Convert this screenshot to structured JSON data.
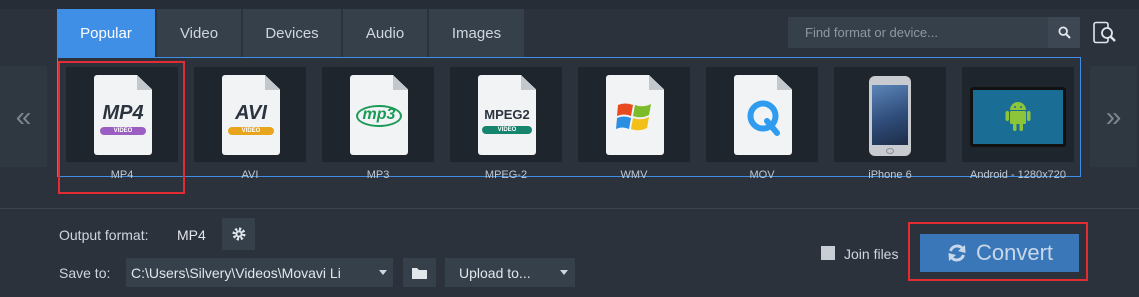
{
  "tabs": [
    {
      "label": "Popular",
      "active": true
    },
    {
      "label": "Video",
      "active": false
    },
    {
      "label": "Devices",
      "active": false
    },
    {
      "label": "Audio",
      "active": false
    },
    {
      "label": "Images",
      "active": false
    }
  ],
  "search": {
    "placeholder": "Find format or device..."
  },
  "nav": {
    "prev": "«",
    "next": "»"
  },
  "formats": [
    {
      "label": "MP4",
      "badge": "MP4",
      "sub": "VIDEO",
      "selected": true
    },
    {
      "label": "AVI",
      "badge": "AVI",
      "sub": "VIDEO"
    },
    {
      "label": "MP3",
      "badge": "mp3"
    },
    {
      "label": "MPEG-2",
      "badge": "MPEG2",
      "sub": "VIDEO"
    },
    {
      "label": "WMV"
    },
    {
      "label": "MOV"
    },
    {
      "label": "iPhone 6"
    },
    {
      "label": "Android - 1280x720"
    }
  ],
  "output": {
    "label": "Output format:",
    "value": "MP4"
  },
  "save": {
    "label": "Save to:",
    "path": "C:\\Users\\Silvery\\Videos\\Movavi Li"
  },
  "upload": {
    "label": "Upload to..."
  },
  "join": {
    "label": "Join files",
    "checked": false
  },
  "convert": {
    "label": "Convert"
  },
  "colors": {
    "accent": "#3f8fe6",
    "convert": "#3a77b8",
    "highlight": "#e32b33",
    "background": "#2b323c"
  }
}
